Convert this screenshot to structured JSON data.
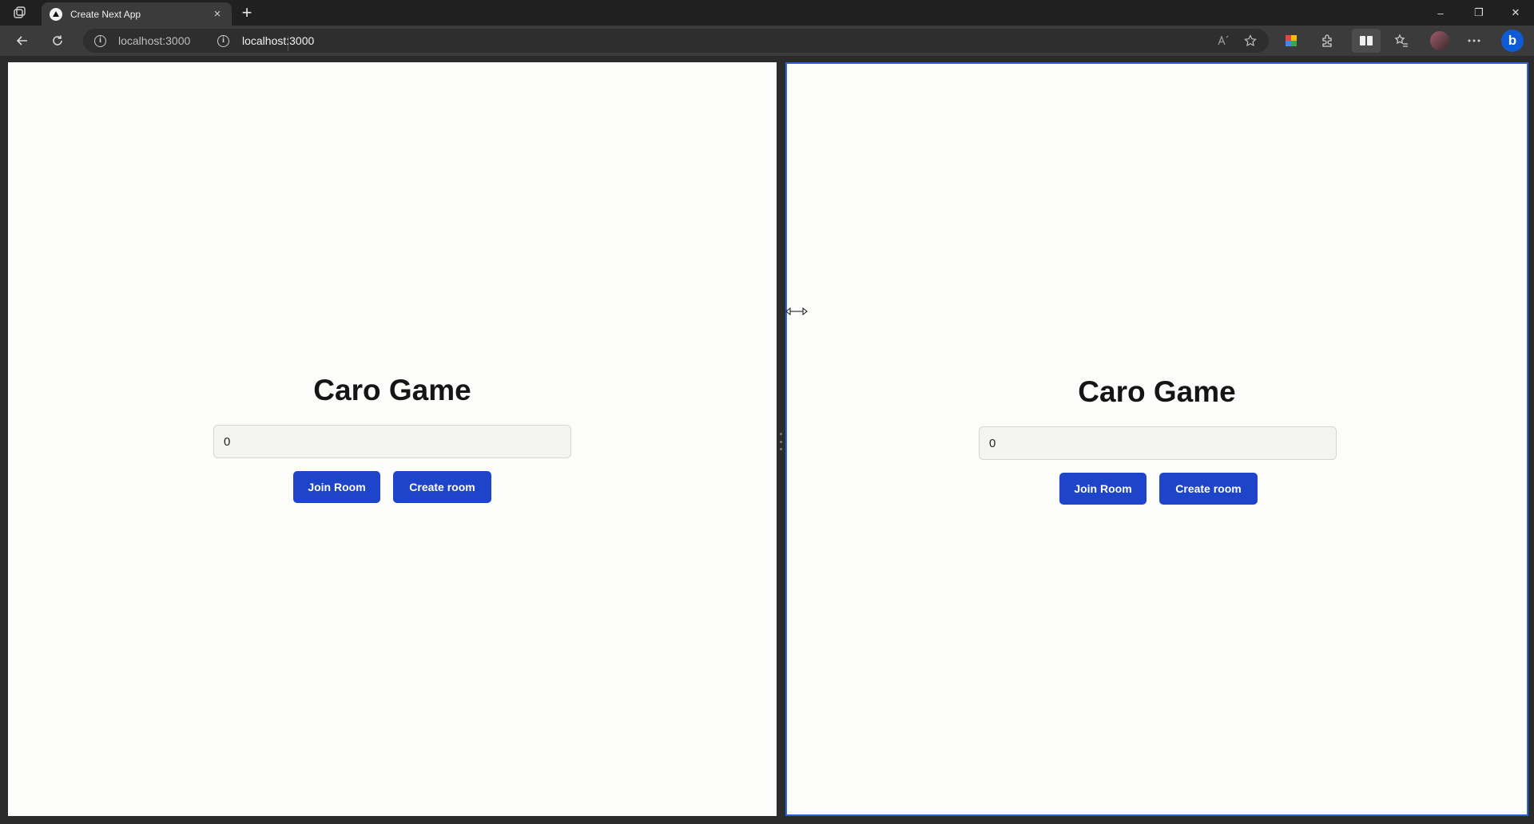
{
  "browser": {
    "tab_title": "Create Next App",
    "new_tab_symbol": "+",
    "close_tab_symbol": "×",
    "address_left": "localhost:3000",
    "address_right": "localhost:3000",
    "window_controls": {
      "minimize": "–",
      "restore": "❐",
      "close": "✕"
    }
  },
  "panes": {
    "left": {
      "title": "Caro Game",
      "room_input_value": "0",
      "join_button": "Join Room",
      "create_button": "Create room"
    },
    "right": {
      "title": "Caro Game",
      "room_input_value": "0",
      "join_button": "Join Room",
      "create_button": "Create room"
    }
  },
  "colors": {
    "button": "#1d44c9",
    "active_pane_border": "#2b63d6",
    "page_background": "#fcfcfa"
  }
}
